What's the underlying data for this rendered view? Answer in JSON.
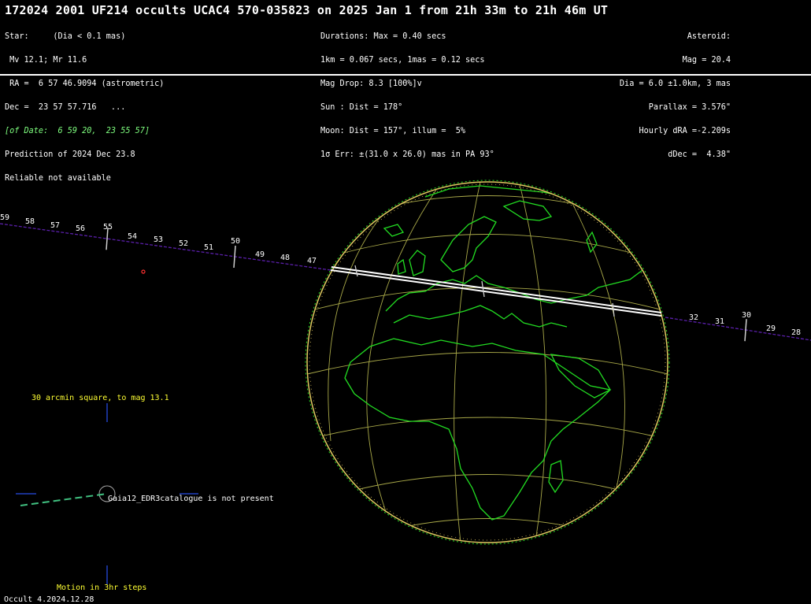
{
  "title": "172024 2001 UF214 occults UCAC4 570-035823 on 2025 Jan  1 from 21h 33m to 21h 46m UT",
  "col1": [
    "Star:     (Dia < 0.1 mas)",
    " Mv 12.1; Mr 11.6",
    " RA =  6 57 46.9094 (astrometric)",
    "Dec =  23 57 57.716   ...",
    "[of Date:  6 59 20,  23 55 57]",
    "Prediction of 2024 Dec 23.8",
    "Reliable not available"
  ],
  "col2": [
    "Durations: Max = 0.40 secs",
    "1km = 0.067 secs, 1mas = 0.12 secs",
    "Mag Drop: 8.3 [100%]v",
    "Sun : Dist = 178°",
    "Moon: Dist = 157°, illum =  5%",
    "1σ Err: ±(31.0 x 26.0) mas in PA 93°"
  ],
  "col3": [
    "Asteroid:",
    "Mag = 20.4",
    "Dia = 6.0 ±1.0km, 3 mas",
    "Parallax = 3.576\"",
    "Hourly dRA =-2.209s",
    "dDec =  4.38\""
  ],
  "colors": {
    "background": "#000000",
    "coastline": "#22dd22",
    "graticule": "#a8a848",
    "path": "#ffffff",
    "track": "#5a1faa",
    "label_yellow": "#ffff33",
    "limb": "#e0c860"
  },
  "track_ticks_left": [
    "59",
    "58",
    "57",
    "56",
    "55",
    "54",
    "53",
    "52",
    "51",
    "50",
    "49",
    "48",
    "47"
  ],
  "track_ticks_right": [
    "32",
    "31",
    "30",
    "29",
    "28"
  ],
  "star_chart_label": "30 arcmin square, to mag 13.1",
  "gaia_note": "Gaia12_EDR3catalogue is not present",
  "motion_label": "Motion in 3hr steps",
  "version": "Occult 4.2024.12.28"
}
